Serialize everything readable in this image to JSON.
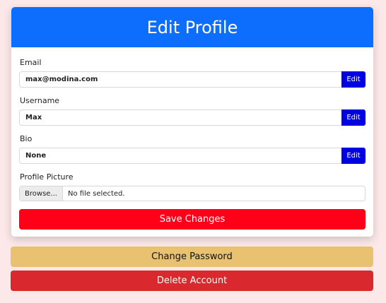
{
  "header": {
    "title": "Edit Profile"
  },
  "fields": {
    "email": {
      "label": "Email",
      "value": "max@modina.com",
      "edit_label": "Edit"
    },
    "username": {
      "label": "Username",
      "value": "Max",
      "edit_label": "Edit"
    },
    "bio": {
      "label": "Bio",
      "value": "None",
      "edit_label": "Edit"
    },
    "picture": {
      "label": "Profile Picture",
      "browse_label": "Browse...",
      "status": "No file selected."
    }
  },
  "actions": {
    "save": "Save Changes",
    "change_password": "Change Password",
    "delete_account": "Delete Account"
  },
  "colors": {
    "background": "#fce8e8",
    "header": "#0d6efd",
    "edit": "#0000e0",
    "save": "#ff0019",
    "change_password": "#e8c270",
    "delete": "#d9282e"
  }
}
